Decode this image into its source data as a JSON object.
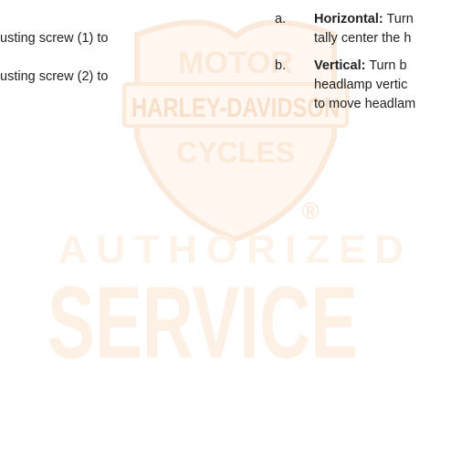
{
  "left_column": {
    "line1": "usting screw (1) to",
    "line2": "usting screw (2) to"
  },
  "right_column": {
    "item_a": {
      "marker": "a.",
      "term": "Horizontal:",
      "text1": " Turn",
      "text2": "tally center the h"
    },
    "item_b": {
      "marker": "b.",
      "term": "Vertical:",
      "text1": " Turn b",
      "text2": "headlamp vertic",
      "text3": "to move headlam"
    }
  },
  "watermark": {
    "badge_line1": "MOTOR",
    "badge_line2": "HARLEY-DAVIDSON",
    "badge_line3": "CYCLES",
    "registered": "®",
    "line1": "AUTHORIZED",
    "line2": "SERVICE",
    "color": "#fdf3e9"
  }
}
